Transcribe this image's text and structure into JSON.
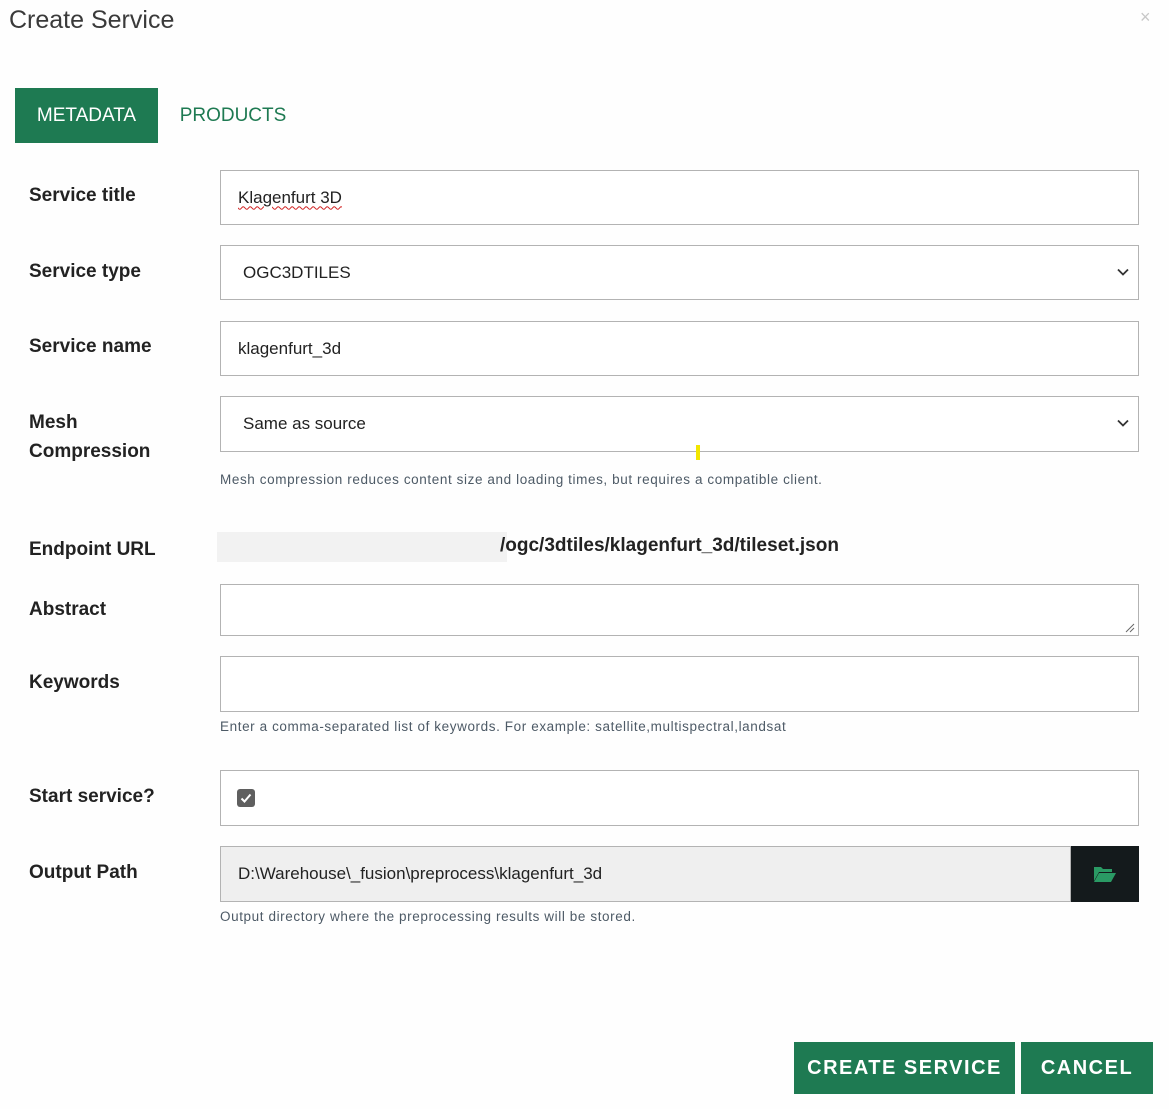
{
  "dialog": {
    "title": "Create Service",
    "close_glyph": "×"
  },
  "tabs": [
    {
      "label": "METADATA",
      "active": true
    },
    {
      "label": "PRODUCTS",
      "active": false
    }
  ],
  "form": {
    "service_title": {
      "label": "Service title",
      "value": "Klagenfurt 3D"
    },
    "service_type": {
      "label": "Service type",
      "value": "OGC3DTILES"
    },
    "service_name": {
      "label": "Service name",
      "value": "klagenfurt_3d"
    },
    "mesh_compression": {
      "label_line1": "Mesh",
      "label_line2": "Compression",
      "value": "Same as source",
      "help": "Mesh compression reduces content size and loading times, but requires a compatible client."
    },
    "endpoint_url": {
      "label": "Endpoint URL",
      "value": "/ogc/3dtiles/klagenfurt_3d/tileset.json"
    },
    "abstract": {
      "label": "Abstract",
      "value": ""
    },
    "keywords": {
      "label": "Keywords",
      "value": "",
      "help": "Enter a comma-separated list of keywords. For example: satellite,multispectral,landsat"
    },
    "start_service": {
      "label": "Start service?",
      "checked": true
    },
    "output_path": {
      "label": "Output Path",
      "value": "D:\\Warehouse\\_fusion\\preprocess\\klagenfurt_3d",
      "help": "Output directory where the preprocessing results will be stored."
    }
  },
  "buttons": {
    "create": "CREATE SERVICE",
    "cancel": "CANCEL"
  },
  "icons": {
    "close": "close-icon",
    "chevron": "chevron-down-icon",
    "folder": "folder-open-icon",
    "check": "check-icon",
    "resize": "resize-handle-icon"
  },
  "colors": {
    "accent": "#1e7a52",
    "browse_button": "#141a1c",
    "help_text": "#4d5a66"
  }
}
